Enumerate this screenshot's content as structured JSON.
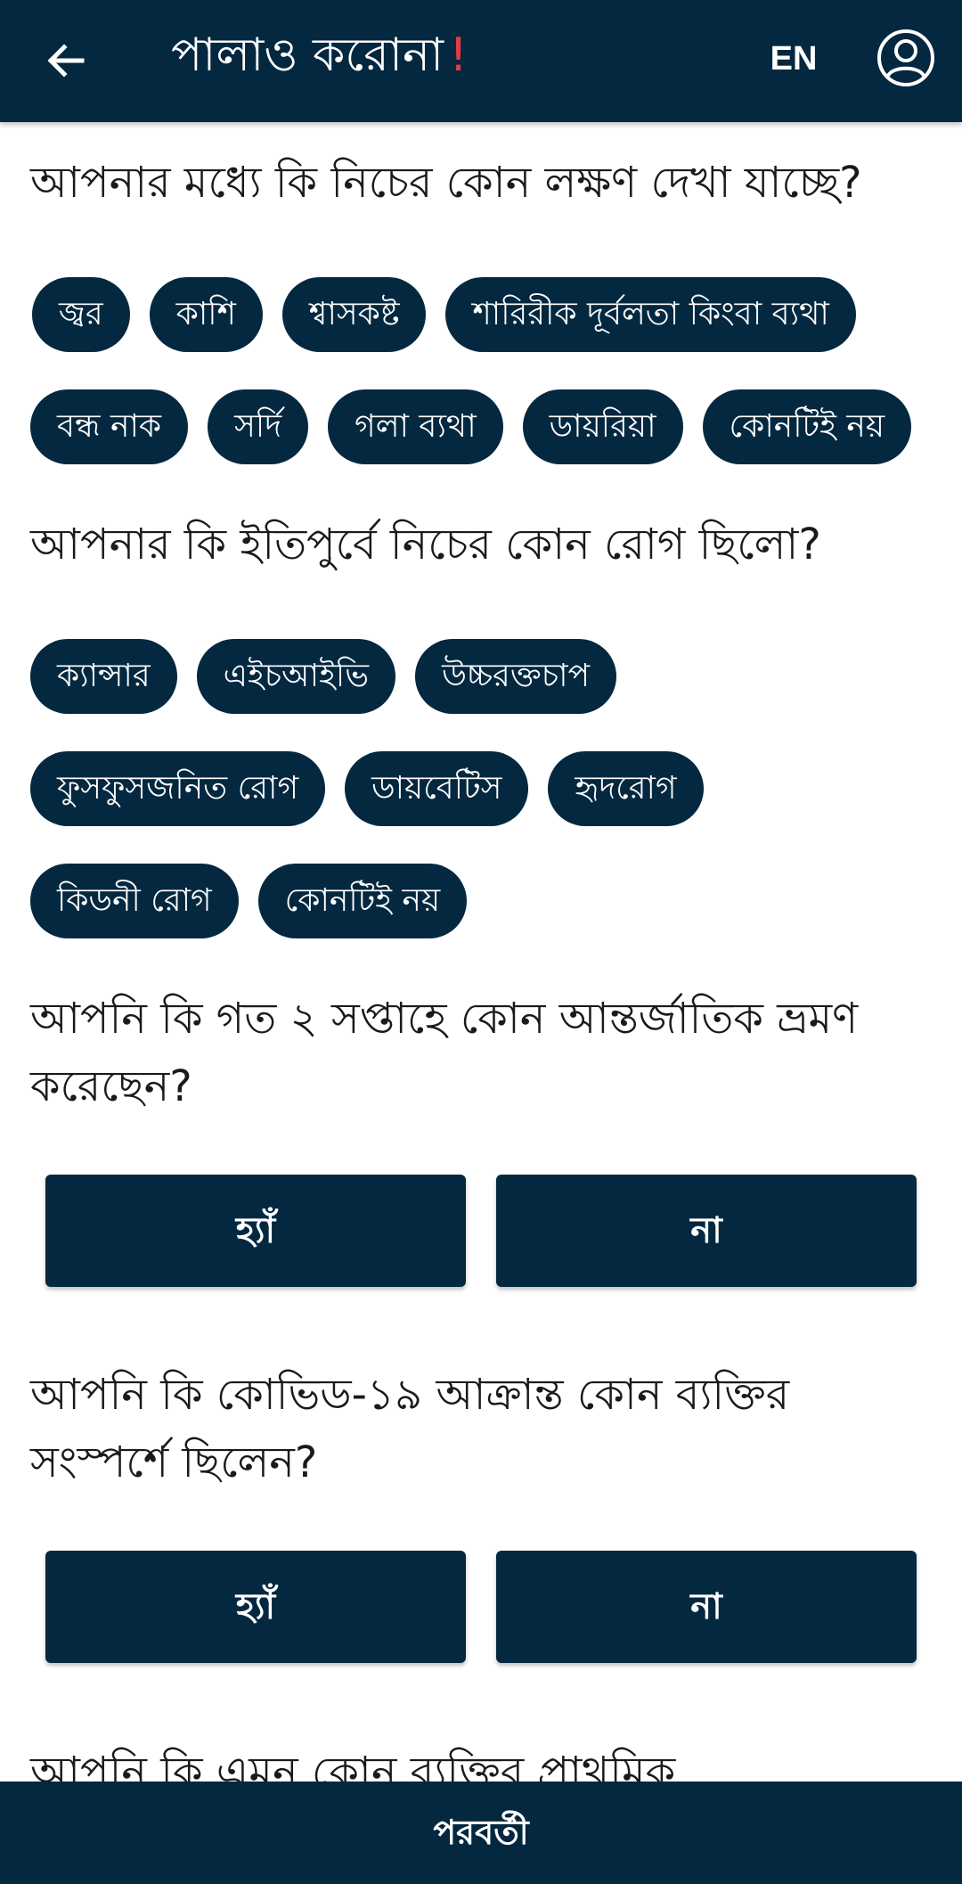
{
  "header": {
    "back_icon": "arrow-left-icon",
    "title": "পালাও করোনা",
    "title_accent": "!",
    "language_button": "EN",
    "profile_icon": "user-circle-icon",
    "bar_color": "#04283f",
    "accent_color": "#e63946"
  },
  "questions": {
    "q1": {
      "text": "আপনার মধ্যে কি নিচের কোন লক্ষণ দেখা যাচ্ছে?",
      "options": [
        "জ্বর",
        "কাশি",
        "শ্বাসকষ্ট",
        "শারিরীক দূর্বলতা কিংবা ব্যথা",
        "বন্ধ নাক",
        "সর্দি",
        "গলা ব্যথা",
        "ডায়রিয়া",
        "কোনটিই নয়"
      ]
    },
    "q2": {
      "text": "আপনার কি ইতিপুর্বে নিচের কোন রোগ ছিলো?",
      "options": [
        "ক্যান্সার",
        "এইচআইভি",
        "উচ্চরক্তচাপ",
        "ফুসফুসজনিত রোগ",
        "ডায়বেটিস",
        "হৃদরোগ",
        "কিডনী রোগ",
        "কোনটিই নয়"
      ]
    },
    "q3": {
      "text": "আপনি কি গত ২ সপ্তাহে কোন আন্তর্জাতিক ভ্রমণ করেছেন?",
      "yes": "হ্যাঁ",
      "no": "না"
    },
    "q4": {
      "text": "আপনি কি কোভিড-১৯ আক্রান্ত কোন ব্যক্তির সংস্পর্শে ছিলেন?",
      "yes": "হ্যাঁ",
      "no": "না"
    },
    "q5": {
      "text": "আপনি কি এমন কোন ব্যক্তির প্রাথমিক"
    }
  },
  "footer": {
    "next_label": "পরবর্তী"
  }
}
